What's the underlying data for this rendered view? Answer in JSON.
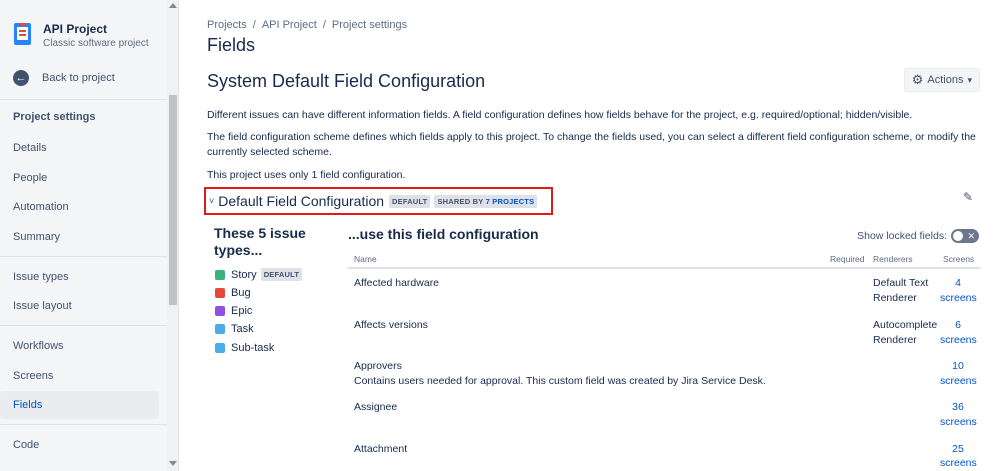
{
  "sidebar": {
    "project_name": "API Project",
    "project_type": "Classic software project",
    "back_label": "Back to project",
    "section_heading": "Project settings",
    "items": [
      {
        "label": "Details"
      },
      {
        "label": "People"
      },
      {
        "label": "Automation"
      },
      {
        "label": "Summary"
      },
      {
        "label": "Issue types"
      },
      {
        "label": "Issue layout"
      },
      {
        "label": "Workflows"
      },
      {
        "label": "Screens"
      },
      {
        "label": "Fields"
      },
      {
        "label": "Code"
      }
    ],
    "active_item": "Fields"
  },
  "breadcrumb": [
    "Projects",
    "API Project",
    "Project settings"
  ],
  "page": {
    "title": "Fields",
    "section_title": "System Default Field Configuration",
    "actions_label": "Actions",
    "para1": "Different issues can have different information fields. A field configuration defines how fields behave for the project, e.g. required/optional; hidden/visible.",
    "para2": "The field configuration scheme defines which fields apply to this project. To change the fields used, you can select a different field configuration scheme, or modify the currently selected scheme.",
    "para3": "This project uses only 1 field configuration."
  },
  "config": {
    "name": "Default Field Configuration",
    "default_lozenge": "DEFAULT",
    "shared_prefix": "SHARED BY",
    "shared_link": "7 PROJECTS"
  },
  "issue_types": {
    "title": "These 5 issue types...",
    "items": [
      {
        "label": "Story",
        "icon": "story-icon",
        "color": "#36B37E",
        "badge": "DEFAULT"
      },
      {
        "label": "Bug",
        "icon": "bug-icon",
        "color": "#E5493A"
      },
      {
        "label": "Epic",
        "icon": "epic-icon",
        "color": "#904EE2"
      },
      {
        "label": "Task",
        "icon": "task-icon",
        "color": "#4BADE8"
      },
      {
        "label": "Sub-task",
        "icon": "subtask-icon",
        "color": "#4BADE8"
      }
    ]
  },
  "fields": {
    "title": "...use this field configuration",
    "show_locked_label": "Show locked fields:",
    "columns": {
      "name": "Name",
      "required": "Required",
      "renderers": "Renderers",
      "screens": "Screens"
    },
    "rows": [
      {
        "name": "Affected hardware",
        "desc": "",
        "renderer1": "Default Text",
        "renderer2": "Renderer",
        "screens_num": "4",
        "screens_word": "screens"
      },
      {
        "name": "Affects versions",
        "desc": "",
        "renderer1": "Autocomplete",
        "renderer2": "Renderer",
        "screens_num": "6",
        "screens_word": "screens"
      },
      {
        "name": "Approvers",
        "desc": "Contains users needed for approval. This custom field was created by Jira Service Desk.",
        "renderer1": "",
        "renderer2": "",
        "screens_num": "10",
        "screens_word": "screens"
      },
      {
        "name": "Assignee",
        "desc": "",
        "renderer1": "",
        "renderer2": "",
        "screens_num": "36",
        "screens_word": "screens"
      },
      {
        "name": "Attachment",
        "desc": "",
        "renderer1": "",
        "renderer2": "",
        "screens_num": "25",
        "screens_word": "screens"
      }
    ]
  },
  "colors": {
    "accent": "#0052CC",
    "highlight_border": "#E01A1A"
  }
}
